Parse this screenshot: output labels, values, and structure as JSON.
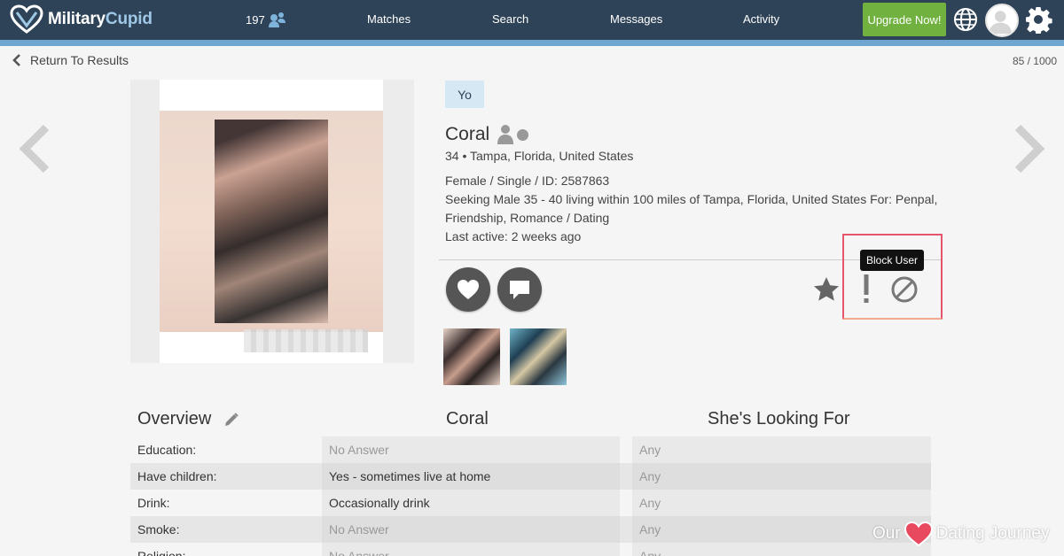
{
  "header": {
    "logo_military": "Military",
    "logo_cupid": "Cupid",
    "online_count": "197",
    "nav": [
      "Matches",
      "Search",
      "Messages",
      "Activity"
    ],
    "upgrade_label": "Upgrade Now!"
  },
  "subheader": {
    "back_label": "Return To Results",
    "counter": "85 / 1000"
  },
  "profile": {
    "tag": "Yo",
    "name": "Coral",
    "location": "34 • Tampa, Florida, United States",
    "details": "Female / Single / ID: 2587863",
    "seeking_line1": "Seeking Male 35 - 40 living within 100 miles of Tampa, Florida, United States For: Penpal,",
    "seeking_line2": "Friendship, Romance / Dating",
    "last_active": "Last active: 2 weeks ago",
    "tooltip": "Block User"
  },
  "overview": {
    "heading": "Overview",
    "col_user": "Coral",
    "col_looking": "She's Looking For",
    "rows": [
      {
        "label": "Education:",
        "value": "No Answer",
        "looking": "Any"
      },
      {
        "label": "Have children:",
        "value": "Yes - sometimes live at home",
        "looking": "Any"
      },
      {
        "label": "Drink:",
        "value": "Occasionally drink",
        "looking": "Any"
      },
      {
        "label": "Smoke:",
        "value": "No Answer",
        "looking": "Any"
      },
      {
        "label": "Religion:",
        "value": "No Answer",
        "looking": "Any"
      }
    ]
  },
  "watermark": {
    "left": "Our",
    "right": "Dating Journey"
  }
}
